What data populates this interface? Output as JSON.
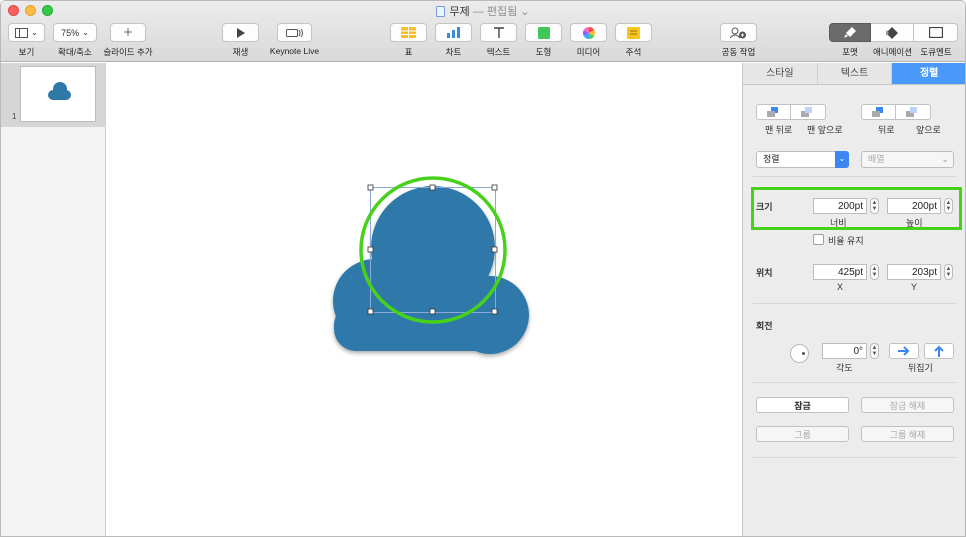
{
  "window": {
    "title": "무제",
    "title_sep": "—",
    "title_status": "편집됨",
    "title_chevron": "⌄"
  },
  "toolbar": {
    "view_label": "보기",
    "zoom_value": "75%",
    "zoom_label": "확대/축소",
    "add_slide_label": "슬라이드 추가",
    "play_label": "재생",
    "keynote_live_label": "Keynote Live",
    "table_label": "표",
    "chart_label": "차트",
    "text_label": "텍스트",
    "shape_label": "도형",
    "media_label": "미디어",
    "comment_label": "주석",
    "collaborate_label": "공동 작업",
    "format_label": "포맷",
    "animate_label": "애니메이션",
    "document_label": "도큐멘트"
  },
  "navigator": {
    "slide_number": "1"
  },
  "inspector": {
    "tabs": [
      "스타일",
      "텍스트",
      "정렬"
    ],
    "active_tab": "정렬",
    "arrange": {
      "back_label": "맨 뒤로",
      "front_label": "맨 앞으로",
      "backward_label": "뒤로",
      "forward_label": "앞으로"
    },
    "align_select": "정렬",
    "distribute_select": "배열",
    "size_label": "크기",
    "width_value": "200pt",
    "width_label": "너비",
    "height_value": "200pt",
    "height_label": "높이",
    "constrain_label": "비율 유지",
    "position_label": "위치",
    "x_value": "425pt",
    "x_label": "X",
    "y_value": "203pt",
    "y_label": "Y",
    "rotate_label": "회전",
    "angle_value": "0°",
    "angle_label": "각도",
    "flip_label": "뒤집기",
    "lock_label": "잠금",
    "unlock_label": "잠금 해제",
    "group_label": "그룹",
    "ungroup_label": "그룹 해제"
  },
  "colors": {
    "accent": "#4a98f7",
    "cloud": "#2f79a9",
    "highlight": "#47d11a"
  }
}
